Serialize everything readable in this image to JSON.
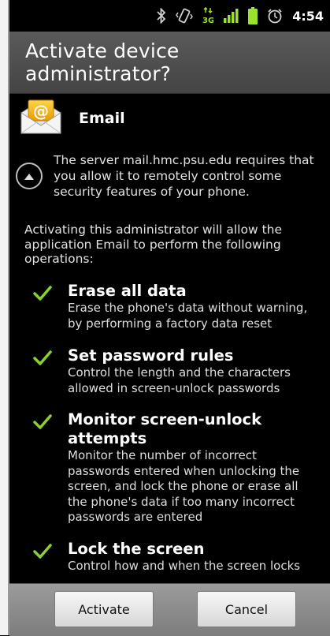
{
  "status_bar": {
    "time": "4:54",
    "icons": [
      "bluetooth-icon",
      "vibrate-icon",
      "data-3g-icon",
      "signal-icon",
      "battery-icon",
      "alarm-icon"
    ]
  },
  "dialog": {
    "title": "Activate device administrator?",
    "app_name": "Email",
    "server_text": "The server mail.hmc.psu.edu requires that you allow it to remotely control some security features of your phone.",
    "activating_text": "Activating this administrator will allow the application Email to perform the following operations:",
    "permissions": [
      {
        "title": "Erase all data",
        "description": "Erase the phone's data without warning, by performing a factory data reset"
      },
      {
        "title": "Set password rules",
        "description": "Control the length and the characters allowed in screen-unlock passwords"
      },
      {
        "title": "Monitor screen-unlock attempts",
        "description": "Monitor the number of incorrect passwords entered when unlocking the screen, and lock the phone or erase all the phone's data if too many incorrect passwords are entered"
      },
      {
        "title": "Lock the screen",
        "description": "Control how and when the screen locks"
      }
    ],
    "buttons": {
      "activate": "Activate",
      "cancel": "Cancel"
    }
  },
  "colors": {
    "check": "#8bd12e",
    "signal": "#9be22d",
    "title_bar": "#505050"
  }
}
